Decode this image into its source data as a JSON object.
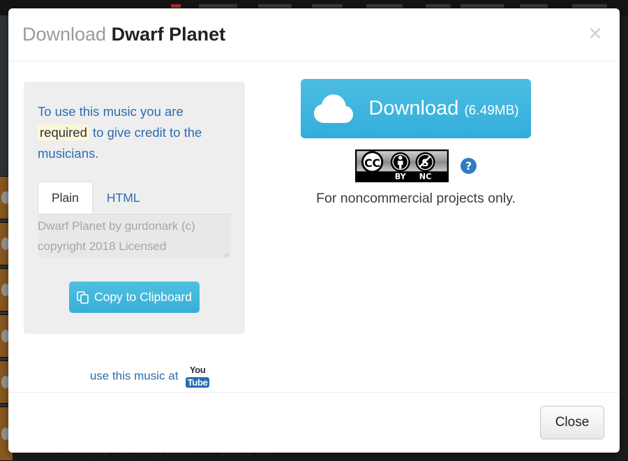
{
  "background": {
    "bottom_text": "Millennium Temple Beginning A A IF SLY Bellos Ten",
    "nav_accent_color": "#b32b2b"
  },
  "modal": {
    "header": {
      "title_prefix": "Download",
      "title_name": "Dwarf Planet",
      "close_icon": "close-icon",
      "close_glyph": "✕"
    },
    "credit": {
      "intro_before": "To use this music you are ",
      "intro_highlight": "required",
      "intro_after": " to give credit to the musicians.",
      "tabs": [
        {
          "label": "Plain",
          "active": true
        },
        {
          "label": "HTML",
          "active": false
        }
      ],
      "attribution_text": "Dwarf Planet by gurdonark (c) copyright 2018 Licensed",
      "copy_button_label": "Copy to Clipboard",
      "copy_icon": "copy-icon",
      "youtube_prefix": "use this music at",
      "youtube_logo_top": "You",
      "youtube_logo_bottom": "Tube"
    },
    "download": {
      "label": "Download",
      "size": "(6.49MB)",
      "icon": "cloud-download-icon",
      "accent_color": "#3bb3de"
    },
    "license": {
      "badge_icon": "creative-commons-by-nc-badge",
      "badge_cc": "CC",
      "badge_by": "BY",
      "badge_nc": "NC",
      "help_icon": "help-question-icon",
      "caption": "For noncommercial projects only."
    },
    "footer": {
      "close_label": "Close"
    }
  }
}
